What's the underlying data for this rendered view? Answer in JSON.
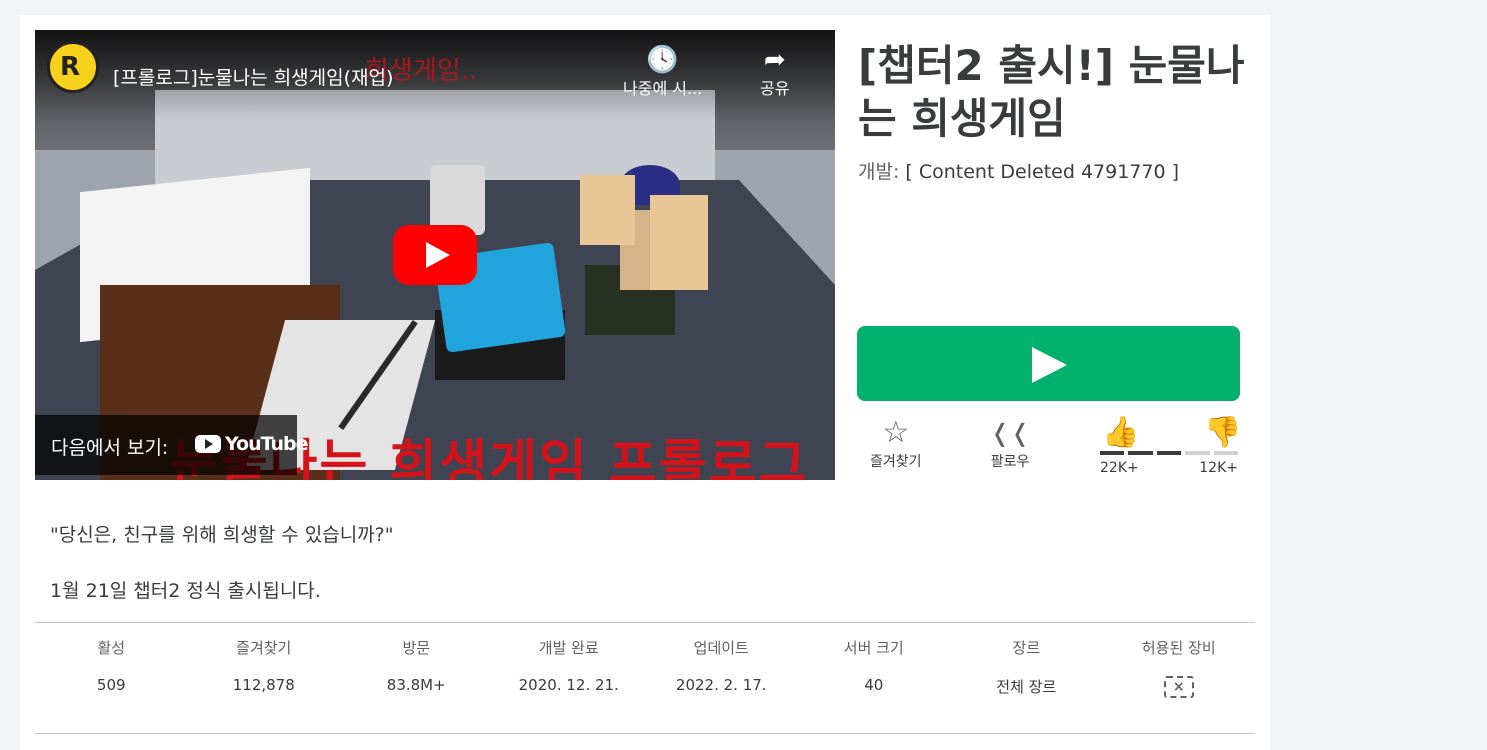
{
  "video": {
    "title": "[프롤로그]눈물나는 희생게임(재업)",
    "overlay_red_top": "희생게임..",
    "overlay_red_bottom": "눈물나는 희생게임 프롤로그",
    "channel_initial": "R",
    "watch_later_label": "나중에 시...",
    "share_label": "공유",
    "watch_on_label": "다음에서 보기:",
    "youtube_label": "YouTube"
  },
  "game": {
    "title": "[챕터2 출시!] 눈물나는 희생게임",
    "developer_prefix": "개발:",
    "developer_name": "[ Content Deleted 4791770 ]"
  },
  "actions": {
    "favorite_label": "즐겨찾기",
    "follow_label": "팔로우",
    "upvotes": "22K+",
    "downvotes": "12K+",
    "like_ratio": 0.65
  },
  "description": {
    "line1": "\"당신은, 친구를 위해 희생할 수 있습니까?\"",
    "line2": "1월 21일 챕터2 정식 출시됩니다."
  },
  "stats": [
    {
      "label": "활성",
      "value": "509"
    },
    {
      "label": "즐겨찾기",
      "value": "112,878"
    },
    {
      "label": "방문",
      "value": "83.8M+"
    },
    {
      "label": "개발 완료",
      "value": "2020. 12. 21."
    },
    {
      "label": "업데이트",
      "value": "2022. 2. 17."
    },
    {
      "label": "서버 크기",
      "value": "40"
    },
    {
      "label": "장르",
      "value": "전체 장르"
    },
    {
      "label": "허용된 장비",
      "value": ""
    }
  ],
  "colors": {
    "play_green": "#00b06f",
    "youtube_red": "#ff0000",
    "overlay_red": "#d4121a"
  },
  "icons": [
    "watch-later-icon",
    "share-icon",
    "star-icon",
    "rss-icon",
    "thumbs-up-icon",
    "thumbs-down-icon",
    "no-gear-icon"
  ]
}
